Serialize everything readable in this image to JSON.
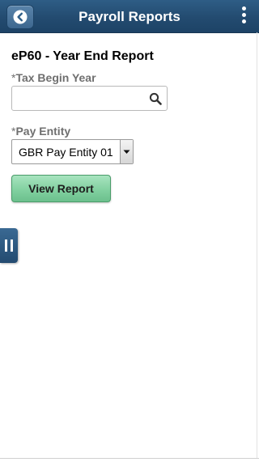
{
  "header": {
    "title": "Payroll Reports",
    "back_icon": "chevron-left-icon",
    "menu_icon": "kebab-menu-icon",
    "color": "#234b70"
  },
  "report": {
    "title": "eP60 - Year End Report"
  },
  "fields": {
    "tax_begin_year": {
      "required_mark": "*",
      "label": "Tax Begin Year",
      "value": "",
      "icon": "search-icon"
    },
    "pay_entity": {
      "required_mark": "*",
      "label": "Pay Entity",
      "selected": "GBR Pay Entity 01"
    }
  },
  "actions": {
    "view_report_label": "View Report",
    "color": "#7fcf9e"
  },
  "side_tab": {
    "icon": "pause-icon"
  }
}
